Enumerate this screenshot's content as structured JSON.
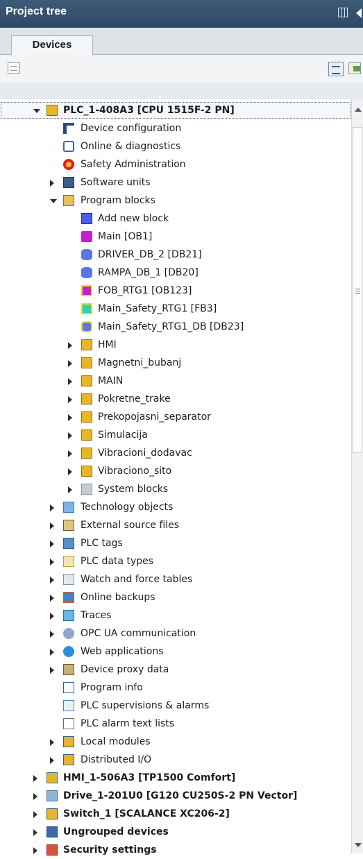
{
  "panel": {
    "title": "Project tree"
  },
  "tabs": [
    {
      "label": "Devices"
    }
  ],
  "colors": {
    "titlebar": "#35506d",
    "folder": "#e7b526",
    "db": "#5d74e6",
    "ob": "#c51fcf",
    "fb": "#2bd2b8"
  },
  "tree": [
    {
      "label": "PLC_1-408A3 [CPU 1515F-2 PN]",
      "level": 0,
      "expander": "down",
      "icon": "plc-icon",
      "selected": true
    },
    {
      "label": "Device configuration",
      "level": 1,
      "expander": "none",
      "icon": "device-config-icon"
    },
    {
      "label": "Online & diagnostics",
      "level": 1,
      "expander": "none",
      "icon": "diagnostics-icon"
    },
    {
      "label": "Safety Administration",
      "level": 1,
      "expander": "none",
      "icon": "safety-icon"
    },
    {
      "label": "Software units",
      "level": 1,
      "expander": "right",
      "icon": "software-units-icon"
    },
    {
      "label": "Program blocks",
      "level": 1,
      "expander": "down",
      "icon": "program-blocks-icon"
    },
    {
      "label": "Add new block",
      "level": 2,
      "expander": "none",
      "icon": "add-block-icon"
    },
    {
      "label": "Main [OB1]",
      "level": 2,
      "expander": "none",
      "icon": "ob-icon"
    },
    {
      "label": "DRIVER_DB_2 [DB21]",
      "level": 2,
      "expander": "none",
      "icon": "db-icon"
    },
    {
      "label": "RAMPA_DB_1 [DB20]",
      "level": 2,
      "expander": "none",
      "icon": "db-icon"
    },
    {
      "label": "FOB_RTG1 [OB123]",
      "level": 2,
      "expander": "none",
      "icon": "safety-ob-icon"
    },
    {
      "label": "Main_Safety_RTG1 [FB3]",
      "level": 2,
      "expander": "none",
      "icon": "fb-icon"
    },
    {
      "label": "Main_Safety_RTG1_DB [DB23]",
      "level": 2,
      "expander": "none",
      "icon": "safety-db-icon"
    },
    {
      "label": "HMI",
      "level": 2,
      "expander": "right",
      "icon": "group-folder-icon"
    },
    {
      "label": "Magnetni_bubanj",
      "level": 2,
      "expander": "right",
      "icon": "group-folder-icon"
    },
    {
      "label": "MAIN",
      "level": 2,
      "expander": "right",
      "icon": "group-folder-icon"
    },
    {
      "label": "Pokretne_trake",
      "level": 2,
      "expander": "right",
      "icon": "group-folder-icon"
    },
    {
      "label": "Prekopojasni_separator",
      "level": 2,
      "expander": "right",
      "icon": "group-folder-icon"
    },
    {
      "label": "Simulacija",
      "level": 2,
      "expander": "right",
      "icon": "group-folder-icon"
    },
    {
      "label": "Vibracioni_dodavac",
      "level": 2,
      "expander": "right",
      "icon": "group-folder-icon"
    },
    {
      "label": "Vibraciono_sito",
      "level": 2,
      "expander": "right",
      "icon": "group-folder-icon"
    },
    {
      "label": "System blocks",
      "level": 2,
      "expander": "right",
      "icon": "system-blocks-icon"
    },
    {
      "label": "Technology objects",
      "level": 1,
      "expander": "right",
      "icon": "technology-objects-icon"
    },
    {
      "label": "External source files",
      "level": 1,
      "expander": "right",
      "icon": "external-source-icon"
    },
    {
      "label": "PLC tags",
      "level": 1,
      "expander": "right",
      "icon": "plc-tags-icon"
    },
    {
      "label": "PLC data types",
      "level": 1,
      "expander": "right",
      "icon": "plc-data-types-icon"
    },
    {
      "label": "Watch and force tables",
      "level": 1,
      "expander": "right",
      "icon": "watch-tables-icon"
    },
    {
      "label": "Online backups",
      "level": 1,
      "expander": "right",
      "icon": "online-backups-icon"
    },
    {
      "label": "Traces",
      "level": 1,
      "expander": "right",
      "icon": "traces-icon"
    },
    {
      "label": "OPC UA communication",
      "level": 1,
      "expander": "right",
      "icon": "opc-ua-icon"
    },
    {
      "label": "Web applications",
      "level": 1,
      "expander": "right",
      "icon": "web-applications-icon"
    },
    {
      "label": "Device proxy data",
      "level": 1,
      "expander": "right",
      "icon": "device-proxy-icon"
    },
    {
      "label": "Program info",
      "level": 1,
      "expander": "none",
      "icon": "program-info-icon"
    },
    {
      "label": "PLC supervisions & alarms",
      "level": 1,
      "expander": "none",
      "icon": "supervisions-icon"
    },
    {
      "label": "PLC alarm text lists",
      "level": 1,
      "expander": "none",
      "icon": "alarm-text-icon"
    },
    {
      "label": "Local modules",
      "level": 1,
      "expander": "right",
      "icon": "local-modules-icon"
    },
    {
      "label": "Distributed I/O",
      "level": 1,
      "expander": "right",
      "icon": "distributed-io-icon"
    },
    {
      "label": "HMI_1-506A3 [TP1500 Comfort]",
      "level": 0,
      "expander": "right",
      "icon": "hmi-device-icon"
    },
    {
      "label": "Drive_1-201U0 [G120 CU250S-2 PN Vector]",
      "level": 0,
      "expander": "right",
      "icon": "drive-icon"
    },
    {
      "label": "Switch_1 [SCALANCE XC206-2]",
      "level": 0,
      "expander": "right",
      "icon": "switch-icon"
    },
    {
      "label": "Ungrouped devices",
      "level": 0,
      "expander": "right",
      "icon": "ungrouped-devices-icon"
    },
    {
      "label": "Security settings",
      "level": 0,
      "expander": "right",
      "icon": "security-settings-icon"
    }
  ]
}
